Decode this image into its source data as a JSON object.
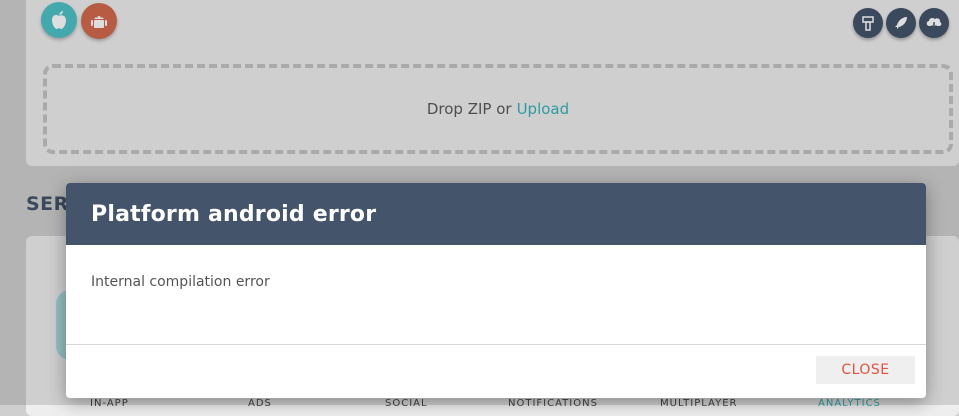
{
  "upload": {
    "drop_text": "Drop ZIP or",
    "upload_link": "Upload"
  },
  "platforms": [
    {
      "icon": "apple-icon",
      "color": "#4fc3c7"
    },
    {
      "icon": "android-icon",
      "color": "#d36a4c"
    }
  ],
  "toolbar_icons": [
    "build-icon",
    "rocket-icon",
    "cloud-download-icon"
  ],
  "section": {
    "heading": "SER"
  },
  "background_tabs": [
    "IN-APP",
    "ADS",
    "SOCIAL",
    "NOTIFICATIONS",
    "MULTIPLAYER",
    "ANALYTICS"
  ],
  "modal": {
    "title": "Platform android error",
    "message": "Internal compilation error",
    "close_label": "CLOSE"
  },
  "colors": {
    "header": "#44546a",
    "accent": "#36b3b8",
    "danger": "#e0533e"
  }
}
